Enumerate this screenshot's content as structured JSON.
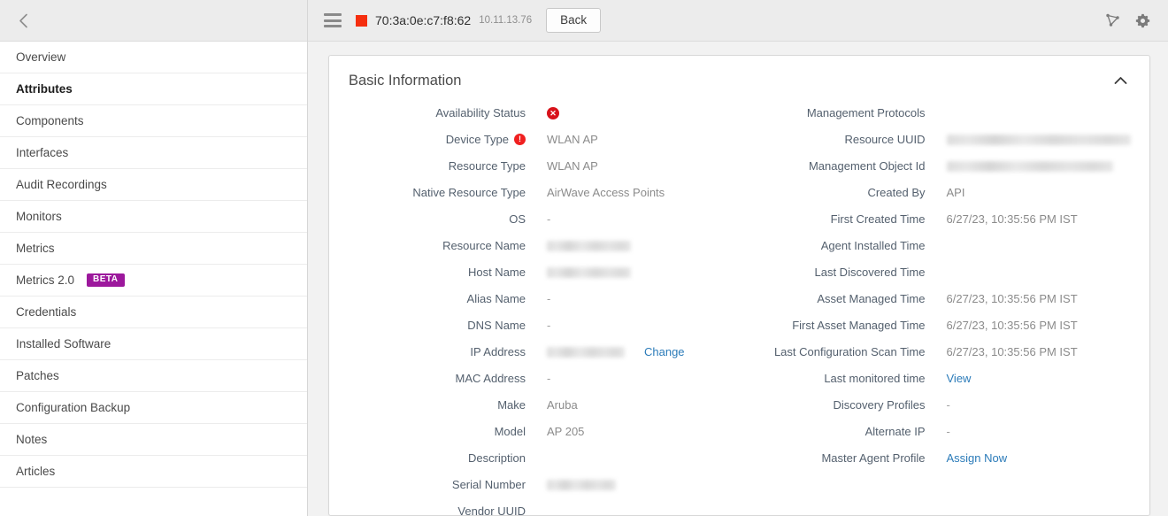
{
  "sidebar": {
    "back_icon": "chevron-left-icon",
    "items": [
      {
        "label": "Overview",
        "active": false
      },
      {
        "label": "Attributes",
        "active": true
      },
      {
        "label": "Components",
        "active": false
      },
      {
        "label": "Interfaces",
        "active": false
      },
      {
        "label": "Audit Recordings",
        "active": false
      },
      {
        "label": "Monitors",
        "active": false
      },
      {
        "label": "Metrics",
        "active": false
      },
      {
        "label": "Metrics 2.0",
        "active": false,
        "badge": "BETA"
      },
      {
        "label": "Credentials",
        "active": false
      },
      {
        "label": "Installed Software",
        "active": false
      },
      {
        "label": "Patches",
        "active": false
      },
      {
        "label": "Configuration Backup",
        "active": false
      },
      {
        "label": "Notes",
        "active": false
      },
      {
        "label": "Articles",
        "active": false
      }
    ]
  },
  "topbar": {
    "menu_icon": "hamburger-menu-icon",
    "status_color": "#f52e0e",
    "device_mac": "70:3a:0e:c7:f8:62",
    "device_ip": "10.11.13.76",
    "back_label": "Back",
    "topology_icon": "topology-icon",
    "settings_icon": "gear-icon"
  },
  "card": {
    "title": "Basic Information",
    "collapse_icon": "chevron-up-icon",
    "left_fields": [
      {
        "label": "Availability Status",
        "type": "status-error"
      },
      {
        "label": "Device Type",
        "type": "text",
        "value": "WLAN AP",
        "label_icon": "warning-icon"
      },
      {
        "label": "Resource Type",
        "type": "text",
        "value": "WLAN AP"
      },
      {
        "label": "Native Resource Type",
        "type": "text",
        "value": "AirWave Access Points"
      },
      {
        "label": "OS",
        "type": "text",
        "value": "-"
      },
      {
        "label": "Resource Name",
        "type": "redacted",
        "width": "w-med"
      },
      {
        "label": "Host Name",
        "type": "redacted",
        "width": "w-med"
      },
      {
        "label": "Alias Name",
        "type": "text",
        "value": "-"
      },
      {
        "label": "DNS Name",
        "type": "text",
        "value": "-"
      },
      {
        "label": "IP Address",
        "type": "redacted-link",
        "width": "w-short",
        "link": "Change"
      },
      {
        "label": "MAC Address",
        "type": "text",
        "value": "-"
      },
      {
        "label": "Make",
        "type": "text",
        "value": "Aruba"
      },
      {
        "label": "Model",
        "type": "text",
        "value": "AP 205"
      },
      {
        "label": "Description",
        "type": "text",
        "value": ""
      },
      {
        "label": "Serial Number",
        "type": "redacted",
        "width": "w-serial"
      },
      {
        "label": "Vendor UUID",
        "type": "text",
        "value": ""
      }
    ],
    "right_fields": [
      {
        "label": "Management Protocols",
        "type": "text",
        "value": ""
      },
      {
        "label": "Resource UUID",
        "type": "redacted",
        "width": "w-long"
      },
      {
        "label": "Management Object Id",
        "type": "redacted",
        "width": "w-long2"
      },
      {
        "label": "Created By",
        "type": "text",
        "value": "API"
      },
      {
        "label": "First Created Time",
        "type": "text",
        "value": "6/27/23, 10:35:56 PM IST"
      },
      {
        "label": "Agent Installed Time",
        "type": "text",
        "value": ""
      },
      {
        "label": "Last Discovered Time",
        "type": "text",
        "value": ""
      },
      {
        "label": "Asset Managed Time",
        "type": "text",
        "value": "6/27/23, 10:35:56 PM IST"
      },
      {
        "label": "First Asset Managed Time",
        "type": "text",
        "value": "6/27/23, 10:35:56 PM IST"
      },
      {
        "label": "Last Configuration Scan Time",
        "type": "text",
        "value": "6/27/23, 10:35:56 PM IST"
      },
      {
        "label": "Last monitored time",
        "type": "link",
        "link": "View"
      },
      {
        "label": "Discovery Profiles",
        "type": "text",
        "value": "-"
      },
      {
        "label": "Alternate IP",
        "type": "text",
        "value": "-"
      },
      {
        "label": "Master Agent Profile",
        "type": "link",
        "link": "Assign Now"
      }
    ]
  }
}
